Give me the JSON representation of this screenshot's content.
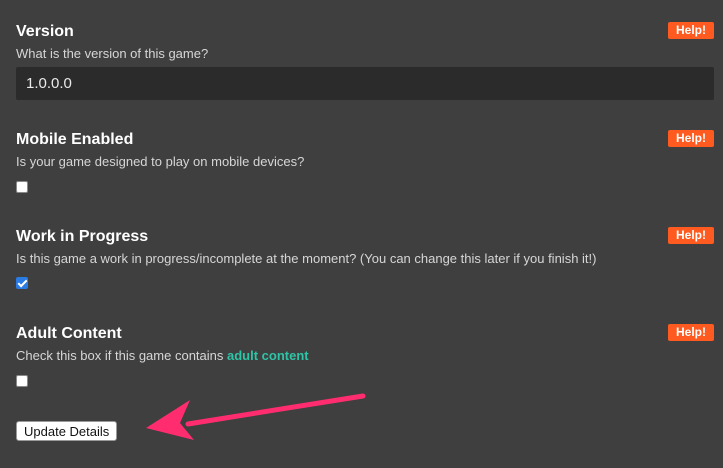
{
  "version": {
    "title": "Version",
    "description": "What is the version of this game?",
    "value": "1.0.0.0",
    "help_label": "Help!"
  },
  "mobile": {
    "title": "Mobile Enabled",
    "description": "Is your game designed to play on mobile devices?",
    "checked": false,
    "help_label": "Help!"
  },
  "wip": {
    "title": "Work in Progress",
    "description": "Is this game a work in progress/incomplete at the moment? (You can change this later if you finish it!)",
    "checked": true,
    "help_label": "Help!"
  },
  "adult": {
    "title": "Adult Content",
    "description_prefix": "Check this box if this game contains ",
    "link_text": "adult content",
    "checked": false,
    "help_label": "Help!"
  },
  "actions": {
    "update_label": "Update Details"
  },
  "colors": {
    "background": "#3f3f3f",
    "help_button": "#ff5a1f",
    "link": "#2ec4a6",
    "annotation_arrow": "#ff2d6f",
    "checkbox_checked": "#2a7be4"
  }
}
